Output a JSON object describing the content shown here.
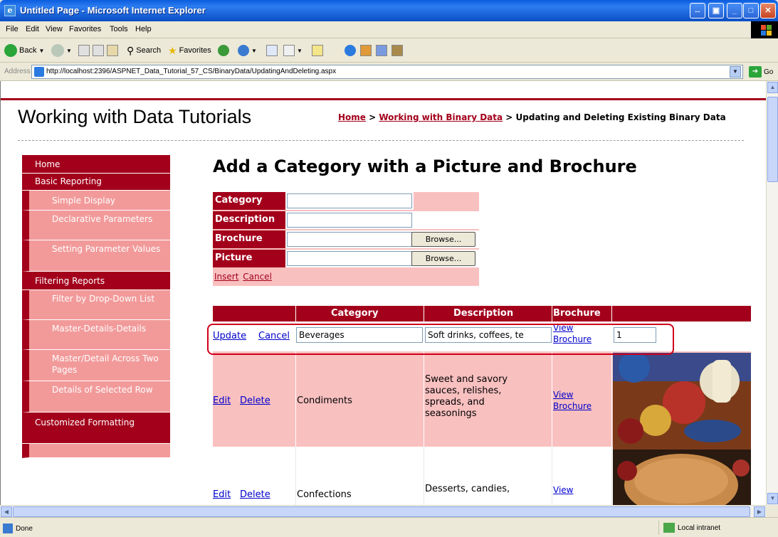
{
  "window": {
    "title": "Untitled Page - Microsoft Internet Explorer"
  },
  "menu": [
    "File",
    "Edit",
    "View",
    "Favorites",
    "Tools",
    "Help"
  ],
  "toolbar": {
    "back": "Back",
    "search": "Search",
    "favorites": "Favorites"
  },
  "address": {
    "label": "Address",
    "url": "http://localhost:2396/ASPNET_Data_Tutorial_57_CS/BinaryData/UpdatingAndDeleting.aspx",
    "go": "Go"
  },
  "site": {
    "title": "Working with Data Tutorials",
    "breadcrumb": {
      "home": "Home",
      "sep1": " > ",
      "section": "Working with Binary Data",
      "sep2": " > ",
      "current": "Updating and Deleting Existing Binary Data"
    }
  },
  "sidebar": {
    "items": [
      {
        "label": "Home",
        "level": 0
      },
      {
        "label": "Basic Reporting",
        "level": 0
      },
      {
        "label": "Simple Display",
        "level": 1
      },
      {
        "label": "Declarative Parameters",
        "level": 1
      },
      {
        "label": "Setting Parameter Values",
        "level": 1
      },
      {
        "label": "Filtering Reports",
        "level": 0
      },
      {
        "label": "Filter by Drop-Down List",
        "level": 1
      },
      {
        "label": "Master-Details-Details",
        "level": 1
      },
      {
        "label": "Master/Detail Across Two Pages",
        "level": 1
      },
      {
        "label": "Details of Selected Row",
        "level": 1
      },
      {
        "label": "Customized Formatting",
        "level": 0
      }
    ]
  },
  "main": {
    "heading": "Add a Category with a Picture and Brochure",
    "insert_form": {
      "fields": [
        {
          "label": "Category",
          "button": ""
        },
        {
          "label": "Description",
          "button": ""
        },
        {
          "label": "Brochure",
          "button": "Browse..."
        },
        {
          "label": "Picture",
          "button": "Browse..."
        }
      ],
      "insert": "Insert",
      "cancel": "Cancel"
    },
    "grid": {
      "columns": [
        "",
        "Category",
        "Description",
        "Brochure",
        ""
      ],
      "editing_row": {
        "update": "Update",
        "cancel": "Cancel",
        "category": "Beverages",
        "description": "Soft drinks, coffees, te",
        "brochure_1": "View",
        "brochure_2": "Brochure",
        "picture_id": "1"
      },
      "rows": [
        {
          "edit": "Edit",
          "delete": "Delete",
          "category": "Condiments",
          "description": "Sweet and savory sauces, relishes, spreads, and seasonings",
          "brochure_1": "View",
          "brochure_2": "Brochure"
        },
        {
          "edit": "Edit",
          "delete": "Delete",
          "category": "Confections",
          "description": "Desserts, candies,",
          "brochure_1": "View",
          "brochure_2": ""
        }
      ]
    }
  },
  "status": {
    "left": "Done",
    "zone": "Local intranet"
  },
  "colors": {
    "accent": "#a3001b",
    "row_pink": "#f9c0c0",
    "link": "#0000cc"
  }
}
